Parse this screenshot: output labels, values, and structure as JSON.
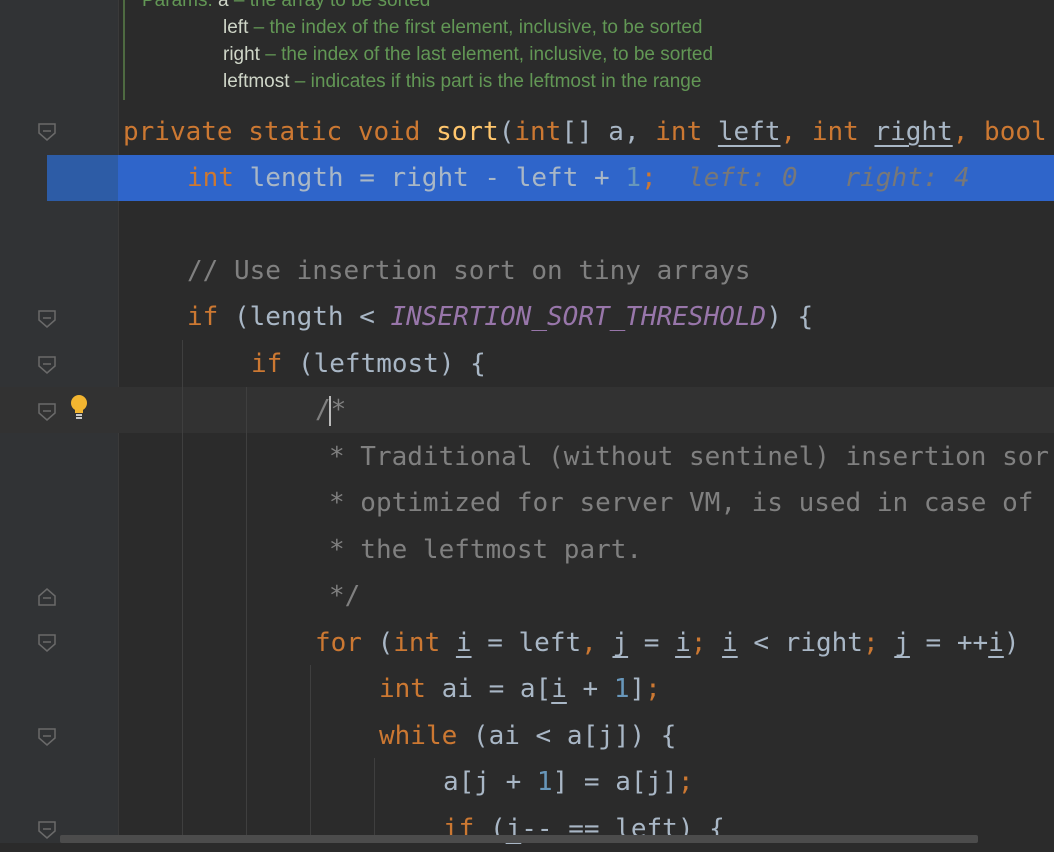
{
  "doc": {
    "line1_label": "Params: ",
    "line1_name": "a",
    "line1_desc": " – the array to be sorted",
    "line2_name": "left",
    "line2_desc": " – the index of the first element, inclusive, to be sorted",
    "line3_name": "right",
    "line3_desc": " – the index of the last element, inclusive, to be sorted",
    "line4_name": "leftmost",
    "line4_desc": " – indicates if this part is the leftmost in the range"
  },
  "code": {
    "sig": {
      "private": "private",
      "static": "static",
      "void": "void",
      "name": "sort",
      "open": "(",
      "int1": "int",
      "arr": "[] a, ",
      "int2": "int",
      "p_left": "left",
      "comma": ", ",
      "int3": "int",
      "p_right": "right",
      "bool": "bool"
    },
    "l2": {
      "int": "int",
      "body": "length = right - left + ",
      "one": "1",
      "semi": ";",
      "hint_left": "left: 0",
      "hint_right": "right: 4"
    },
    "comment1": "// Use insertion sort on tiny arrays",
    "if1": {
      "if": "if",
      "open": " (length < ",
      "const": "INSERTION_SORT_THRESHOLD",
      "close": ") {"
    },
    "if2": {
      "if": "if",
      "rest": " (leftmost) {"
    },
    "block_comment": {
      "l1a": "/",
      "l1b": "*",
      "l2": "* Traditional (without sentinel) insertion sor",
      "l3": "* optimized for server VM, is used in case of",
      "l4": "* the leftmost part.",
      "l5": "*/"
    },
    "for": {
      "for": "for",
      "p1": " (",
      "int": "int",
      "i1": "i",
      "p2": " = left",
      "c1": ",",
      "j1": "j",
      "p3": " = ",
      "i2": "i",
      "s1": ";",
      "i3": "i",
      "p4": " < right",
      "s2": ";",
      "j2": "j",
      "p5": " = ++",
      "i4": "i",
      "p6": ") "
    },
    "ai": {
      "int": "int",
      "a1": "ai = a[",
      "i": "i",
      "a2": " + ",
      "one": "1",
      "a3": "]",
      "semi": ";"
    },
    "while": {
      "while": "while",
      "rest": " (ai < a[j]) {"
    },
    "assign": {
      "a1": "a[j + ",
      "one": "1",
      "a2": "] = a[j]",
      "semi": ";"
    },
    "if3": {
      "if": "if",
      "p1": " (",
      "j": "j",
      "rest": "-- == left) {"
    }
  }
}
